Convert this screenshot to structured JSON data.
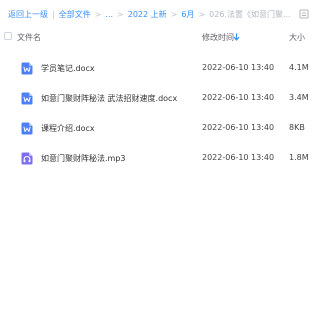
{
  "breadcrumb": {
    "back": "返回上一级",
    "all_files": "全部文件",
    "ellipsis": "...",
    "folder_2022": "2022 上新",
    "folder_june": "6月",
    "current": "026.法置《如意门聚..."
  },
  "header": {
    "name": "文件名",
    "modified": "修改时间",
    "size": "大小"
  },
  "files": [
    {
      "name": "学员笔记.docx",
      "time": "2022-06-10 13:40",
      "size": "4.1M",
      "type": "docx",
      "icon": "word-doc-icon"
    },
    {
      "name": "如意门聚财阵秘法 武法招财速度.docx",
      "time": "2022-06-10 13:40",
      "size": "3.4M",
      "type": "docx",
      "icon": "word-doc-icon"
    },
    {
      "name": "课程介绍.docx",
      "time": "2022-06-10 13:40",
      "size": "8KB",
      "type": "docx",
      "icon": "word-doc-icon"
    },
    {
      "name": "如意门聚财阵秘法.mp3",
      "time": "2022-06-10 13:40",
      "size": "1.8M",
      "type": "mp3",
      "icon": "audio-file-icon"
    }
  ],
  "colors": {
    "link": "#3a8ff5",
    "doc_icon": "#4d80f5",
    "audio_icon": "#7d6ff0"
  }
}
